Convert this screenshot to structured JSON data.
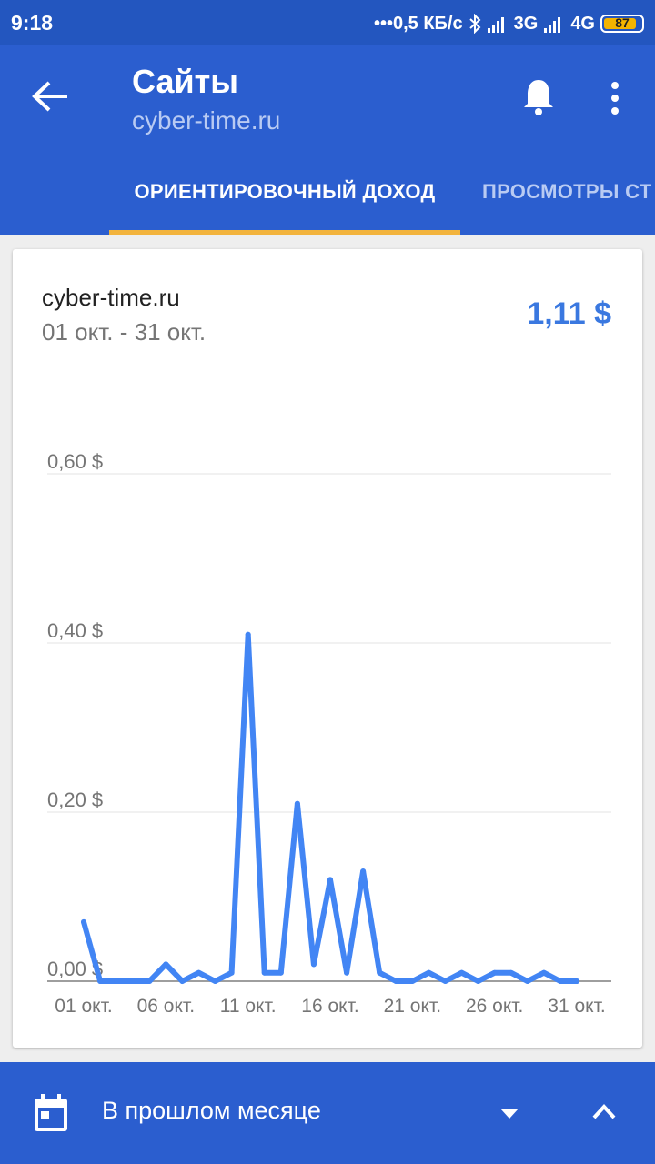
{
  "status_bar": {
    "time": "9:18",
    "speed": "•••0,5 КБ/с",
    "net1": "3G",
    "net2": "4G",
    "battery": "87",
    "battery_level": 0.87
  },
  "app_bar": {
    "title": "Сайты",
    "subtitle": "cyber-time.ru",
    "tabs": [
      "ОРИЕНТИРОВОЧНЫЙ ДОХОД",
      "ПРОСМОТРЫ СТ"
    ]
  },
  "card": {
    "site": "cyber-time.ru",
    "date_range": "01 окт. - 31 окт.",
    "total": "1,11 $"
  },
  "chart_data": {
    "type": "line",
    "color": "#4285f4",
    "x": [
      "01 окт.",
      "02 окт.",
      "03 окт.",
      "04 окт.",
      "05 окт.",
      "06 окт.",
      "07 окт.",
      "08 окт.",
      "09 окт.",
      "10 окт.",
      "11 окт.",
      "12 окт.",
      "13 окт.",
      "14 окт.",
      "15 окт.",
      "16 окт.",
      "17 окт.",
      "18 окт.",
      "19 окт.",
      "20 окт.",
      "21 окт.",
      "22 окт.",
      "23 окт.",
      "24 окт.",
      "25 окт.",
      "26 окт.",
      "27 окт.",
      "28 окт.",
      "29 окт.",
      "30 окт.",
      "31 окт."
    ],
    "values": [
      0.07,
      0.0,
      0.0,
      0.0,
      0.0,
      0.02,
      0.0,
      0.01,
      0.0,
      0.01,
      0.41,
      0.01,
      0.01,
      0.21,
      0.02,
      0.12,
      0.01,
      0.13,
      0.01,
      0.0,
      0.0,
      0.01,
      0.0,
      0.01,
      0.0,
      0.01,
      0.01,
      0.0,
      0.01,
      0.0,
      0.0
    ],
    "xtick_labels": [
      "01 окт.",
      "06 окт.",
      "11 окт.",
      "16 окт.",
      "21 окт.",
      "26 окт.",
      "31 окт."
    ],
    "yticks": [
      0,
      0.2,
      0.4,
      0.6
    ],
    "ytick_labels": [
      "0,00 $",
      "0,20 $",
      "0,40 $",
      "0,60 $"
    ],
    "ylim": [
      0,
      0.6
    ],
    "grid": true
  },
  "bottom_bar": {
    "period": "В прошлом месяце"
  }
}
